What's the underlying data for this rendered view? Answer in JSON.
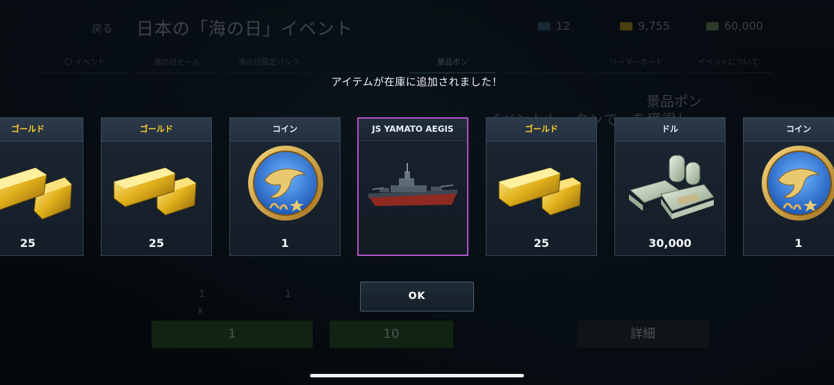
{
  "background": {
    "back_label": "戻る",
    "title": "日本の「海の日」イベント",
    "currencies": [
      {
        "name": "fuel",
        "value": "12",
        "color": "#3d6b8a"
      },
      {
        "name": "gold",
        "value": "9,755",
        "color": "#c9a227"
      },
      {
        "name": "dollars",
        "value": "60,000",
        "color": "#7a9a6a"
      }
    ],
    "tabs": [
      "〇 イベント",
      "海の日セール",
      "海の日限定パック",
      "",
      "景品ポン",
      "",
      "リーダーボード",
      "イベントについて"
    ],
    "active_tab_index": 4,
    "side_title": "景品ポン",
    "description": "イベントトークンで…を獲得し…",
    "button_left_value": "1",
    "button_right_value": "10",
    "details_label": "詳細",
    "counts": [
      "1",
      "1"
    ],
    "x_label": "x"
  },
  "modal": {
    "notice": "アイテムが在庫に追加されました！",
    "ok_label": "OK",
    "accent_color": "#b254c9",
    "items": [
      {
        "label": "ゴールド",
        "icon": "gold-bars-icon",
        "amount": "25",
        "label_style": "gold"
      },
      {
        "label": "ゴールド",
        "icon": "gold-bars-icon",
        "amount": "25",
        "label_style": "gold"
      },
      {
        "label": "コイン",
        "icon": "dolphin-coin-icon",
        "amount": "1",
        "label_style": "white"
      },
      {
        "label": "JS YAMATO AEGIS",
        "icon": "battleship-icon",
        "amount": "",
        "label_style": "white",
        "selected": true
      },
      {
        "label": "ゴールド",
        "icon": "gold-bars-icon",
        "amount": "25",
        "label_style": "gold"
      },
      {
        "label": "ドル",
        "icon": "cash-bundle-icon",
        "amount": "30,000",
        "label_style": "white"
      },
      {
        "label": "コイン",
        "icon": "dolphin-coin-icon",
        "amount": "1",
        "label_style": "white"
      }
    ]
  }
}
